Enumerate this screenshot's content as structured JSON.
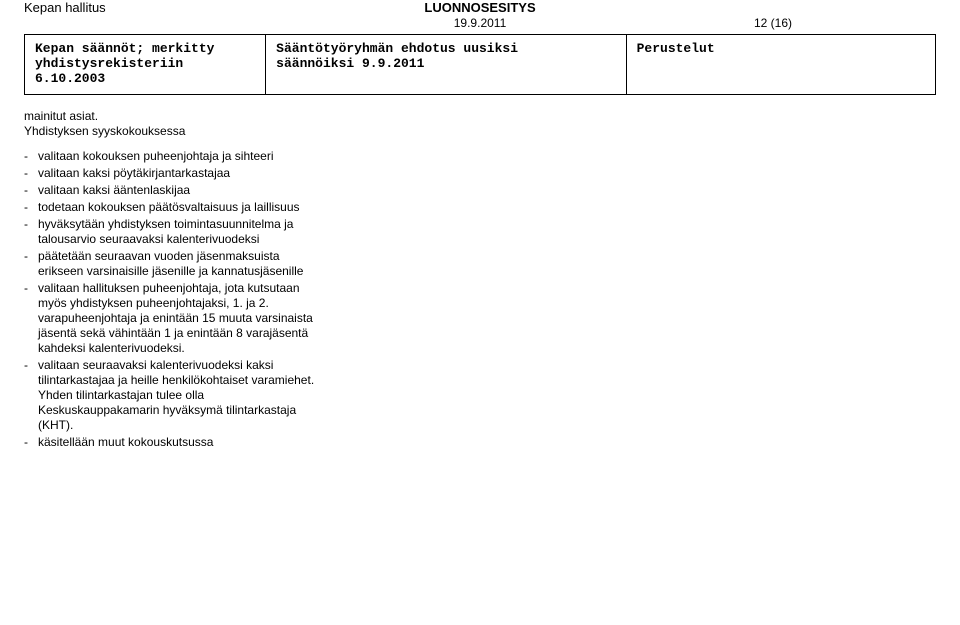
{
  "header": {
    "author": "Kepan hallitus",
    "draft_title": "LUONNOSESITYS",
    "date": "19.9.2011",
    "page_number": "12 (16)"
  },
  "table": {
    "col1_line1": "Kepan säännöt; merkitty",
    "col1_line2": "yhdistysrekisteriin",
    "col1_line3": "6.10.2003",
    "col2_line1": "Sääntötyöryhmän ehdotus uusiksi",
    "col2_line2": "säännöiksi 9.9.2011",
    "col3_line1": "Perustelut"
  },
  "body": {
    "intro_line1": "mainitut asiat.",
    "intro_line2": "Yhdistyksen syyskokouksessa",
    "items": [
      "valitaan kokouksen puheenjohtaja ja sihteeri",
      "valitaan kaksi pöytäkirjantarkastajaa",
      "valitaan kaksi ääntenlaskijaa",
      "todetaan kokouksen päätösvaltaisuus ja laillisuus",
      "hyväksytään yhdistyksen toimintasuunnitelma ja talousarvio seuraavaksi kalenterivuodeksi",
      "päätetään seuraavan vuoden jäsenmaksuista erikseen varsinaisille jäsenille ja kannatusjäsenille",
      "valitaan hallituksen puheenjohtaja, jota kutsutaan myös yhdistyksen puheenjohtajaksi, 1. ja 2. varapuheenjohtaja ja enintään 15 muuta varsinaista jäsentä sekä vähintään 1 ja enintään 8 varajäsentä kahdeksi kalenterivuodeksi.",
      "valitaan seuraavaksi kalenterivuodeksi kaksi tilintarkastajaa ja heille henkilökohtaiset varamiehet. Yhden tilintarkastajan tulee olla Keskuskauppakamarin hyväksymä tilintarkastaja (KHT).",
      "käsitellään muut kokouskutsussa"
    ]
  }
}
